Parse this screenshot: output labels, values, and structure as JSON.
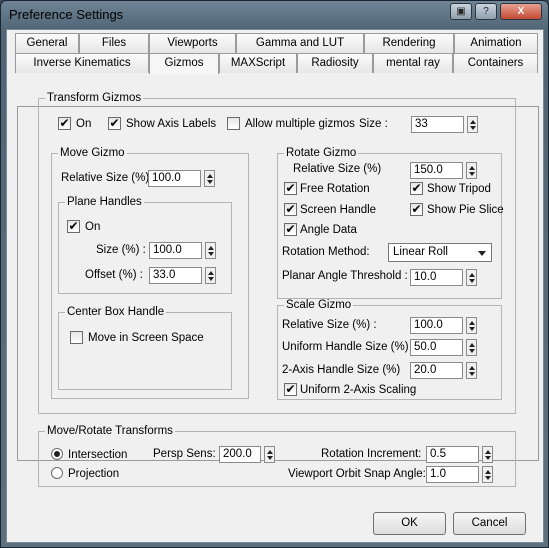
{
  "window": {
    "title": "Preference Settings",
    "buttons": {
      "help": "?",
      "close": "X"
    }
  },
  "tabs": {
    "row1": [
      "General",
      "Files",
      "Viewports",
      "Gamma and LUT",
      "Rendering",
      "Animation"
    ],
    "row2": [
      "Inverse Kinematics",
      "Gizmos",
      "MAXScript",
      "Radiosity",
      "mental ray",
      "Containers"
    ],
    "active": "Gizmos"
  },
  "transform_gizmos": {
    "label": "Transform Gizmos",
    "on": {
      "label": "On",
      "checked": true
    },
    "show_axis_labels": {
      "label": "Show Axis Labels",
      "checked": true
    },
    "allow_multiple": {
      "label": "Allow multiple gizmos",
      "checked": false
    },
    "size_label": "Size :",
    "size_value": "33"
  },
  "move_gizmo": {
    "label": "Move Gizmo",
    "relative_size_label": "Relative Size (%)",
    "relative_size_value": "100.0",
    "plane_handles": {
      "label": "Plane Handles",
      "on": {
        "label": "On",
        "checked": true
      },
      "size_label": "Size (%) :",
      "size_value": "100.0",
      "offset_label": "Offset (%) :",
      "offset_value": "33.0"
    },
    "center_box": {
      "label": "Center Box Handle",
      "screen_space": {
        "label": "Move in Screen Space",
        "checked": false
      }
    }
  },
  "rotate_gizmo": {
    "label": "Rotate Gizmo",
    "relative_size_label": "Relative Size (%)",
    "relative_size_value": "150.0",
    "free_rotation": {
      "label": "Free Rotation",
      "checked": true
    },
    "show_tripod": {
      "label": "Show Tripod",
      "checked": true
    },
    "screen_handle": {
      "label": "Screen Handle",
      "checked": true
    },
    "show_pie_slice": {
      "label": "Show Pie Slice",
      "checked": true
    },
    "angle_data": {
      "label": "Angle Data",
      "checked": true
    },
    "rotation_method_label": "Rotation Method:",
    "rotation_method_value": "Linear Roll",
    "planar_threshold_label": "Planar Angle Threshold :",
    "planar_threshold_value": "10.0"
  },
  "scale_gizmo": {
    "label": "Scale Gizmo",
    "relative_size_label": "Relative Size (%) :",
    "relative_size_value": "100.0",
    "uniform_handle_label": "Uniform Handle Size (%)",
    "uniform_handle_value": "50.0",
    "two_axis_label": "2-Axis Handle Size (%)",
    "two_axis_value": "20.0",
    "uniform_scaling": {
      "label": "Uniform 2-Axis Scaling",
      "checked": true
    }
  },
  "move_rotate": {
    "label": "Move/Rotate Transforms",
    "intersection": {
      "label": "Intersection",
      "selected": true
    },
    "projection": {
      "label": "Projection",
      "selected": false
    },
    "persp_sens_label": "Persp Sens:",
    "persp_sens_value": "200.0",
    "rotation_increment_label": "Rotation Increment:",
    "rotation_increment_value": "0.5",
    "orbit_snap_label": "Viewport Orbit Snap Angle:",
    "orbit_snap_value": "1.0"
  },
  "footer": {
    "ok": "OK",
    "cancel": "Cancel"
  },
  "icons": {
    "check": "✔"
  }
}
